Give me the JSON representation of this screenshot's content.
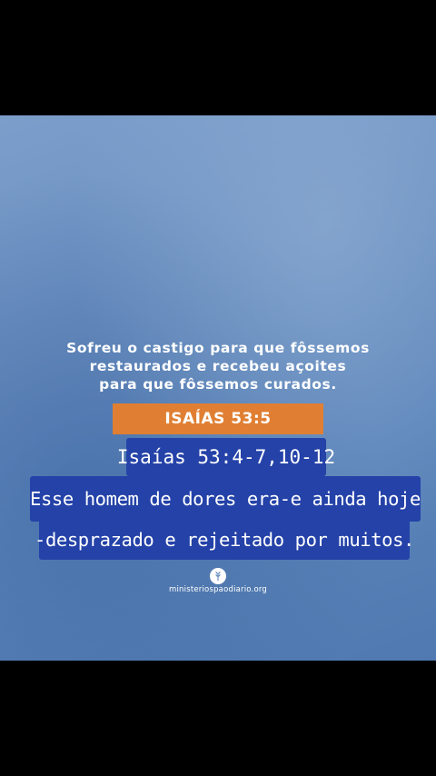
{
  "quote": {
    "lines": [
      "Sofreu o castigo para que fôssemos",
      "restaurados e recebeu açoites",
      "para que fôssemos curados."
    ]
  },
  "reference_badge": "ISAÍAS 53:5",
  "captions": {
    "reference": "Isaías 53:4-7,10-12",
    "line1": "Esse homem de dores era-e ainda hoje",
    "line2": "-desprazado e rejeitado por muitos."
  },
  "branding": {
    "icon": "wheat-leaf-icon",
    "site": "ministeriospaodiario.org"
  },
  "colors": {
    "background_blue": "#6a8fc0",
    "badge_orange": "#e07f33",
    "caption_blue": "#2442a8",
    "text": "#ffffff"
  }
}
